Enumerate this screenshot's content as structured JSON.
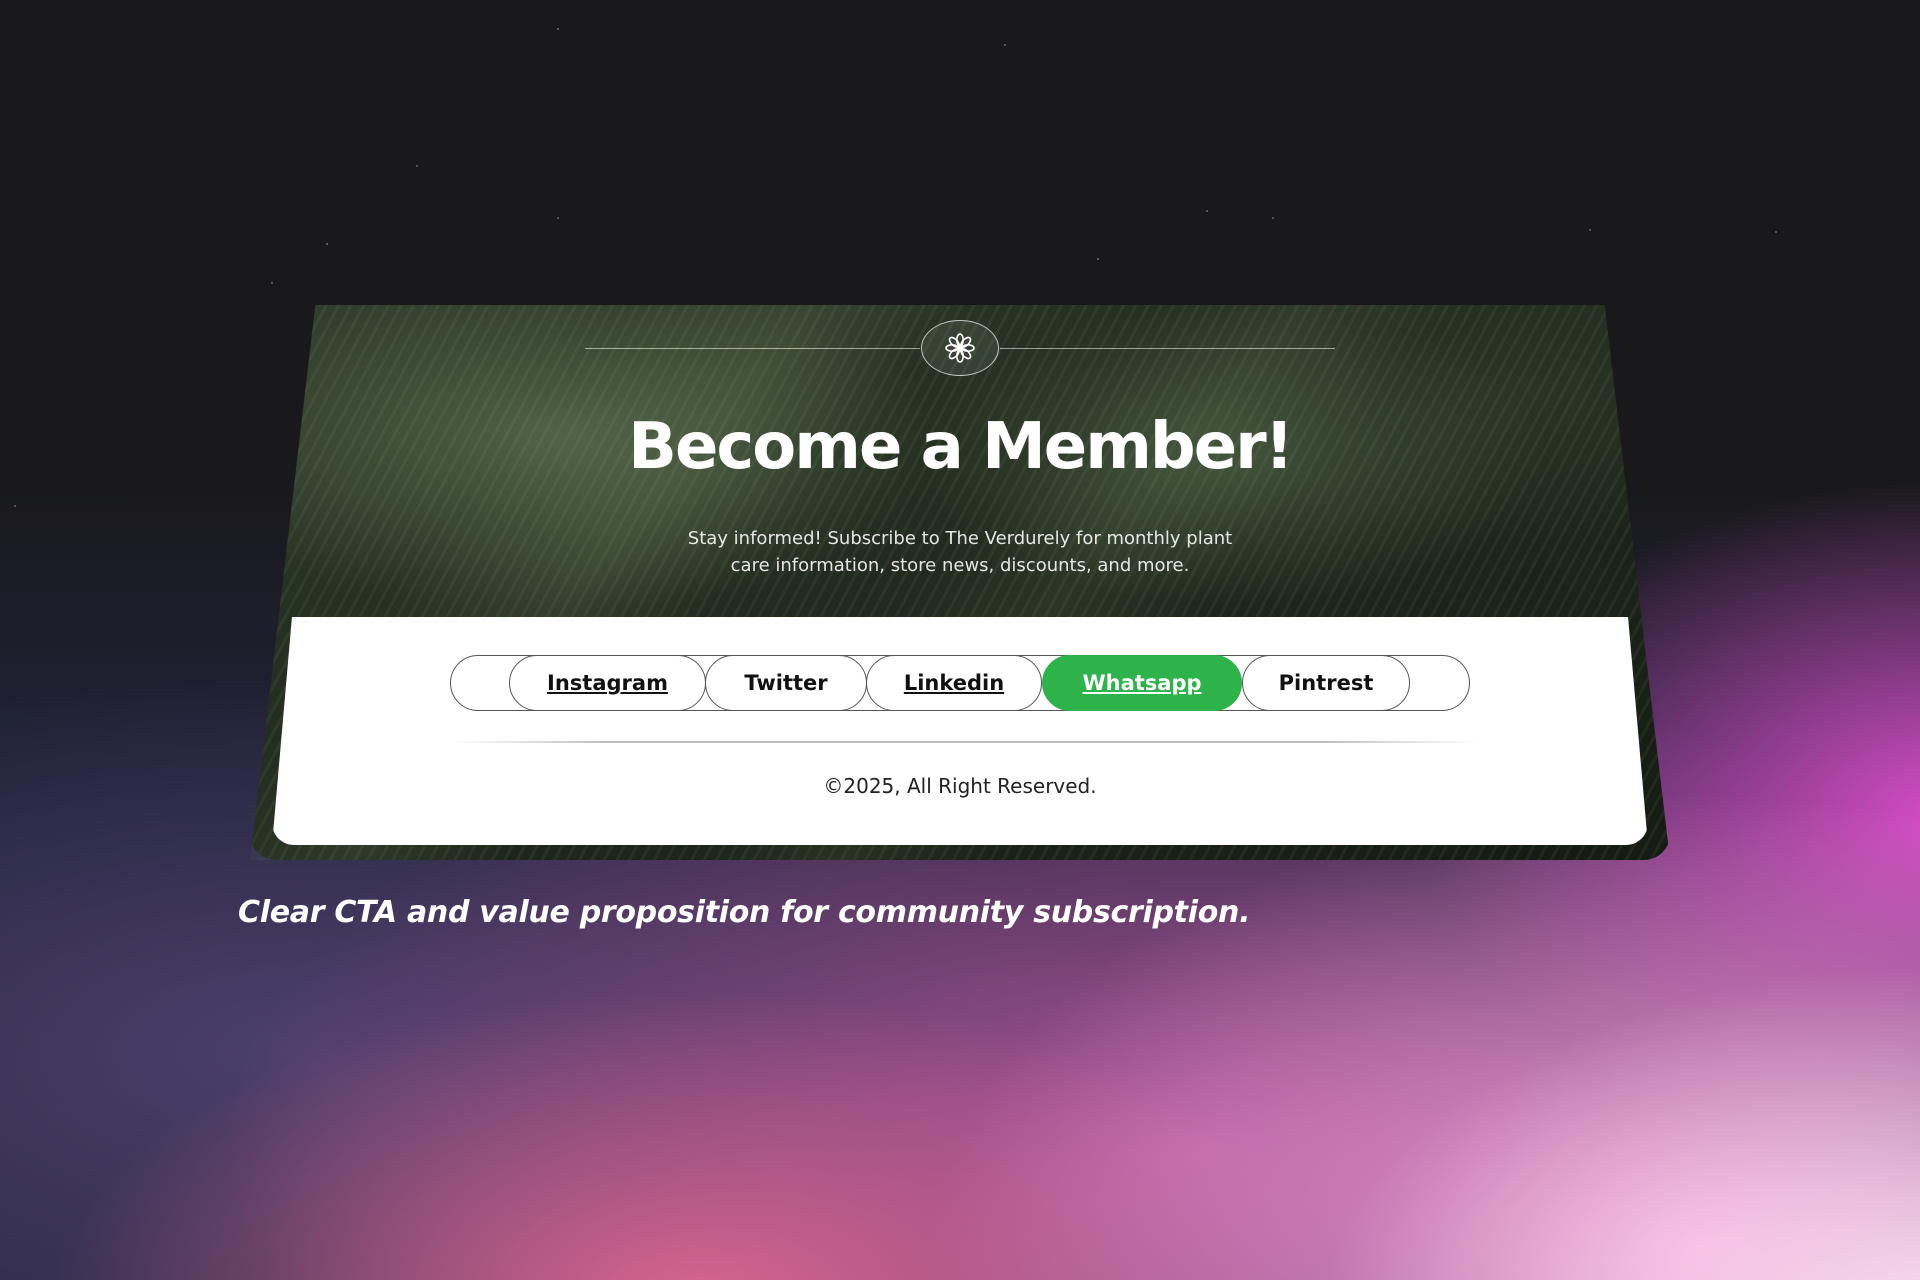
{
  "card": {
    "emblem_icon": "flower-icon",
    "title": "Become a Member!",
    "subtitle_line1": "Stay informed! Subscribe to The Verdurely for monthly plant",
    "subtitle_line2": "care information, store news, discounts, and more.",
    "social_links": [
      {
        "label": "Instagram",
        "underlined": true,
        "active": false
      },
      {
        "label": "Twitter",
        "underlined": false,
        "active": false
      },
      {
        "label": "Linkedin",
        "underlined": true,
        "active": false
      },
      {
        "label": "Whatsapp",
        "underlined": true,
        "active": true
      },
      {
        "label": "Pintrest",
        "underlined": false,
        "active": false
      }
    ],
    "copyright": "©2025, All Right Reserved."
  },
  "caption": "Clear CTA and value proposition for community subscription.",
  "colors": {
    "accent_green": "#2db34a",
    "card_dark_green": "#222b1f",
    "panel": "#ffffff",
    "background_dark": "#18181b",
    "background_pink": "#d94ec9"
  }
}
